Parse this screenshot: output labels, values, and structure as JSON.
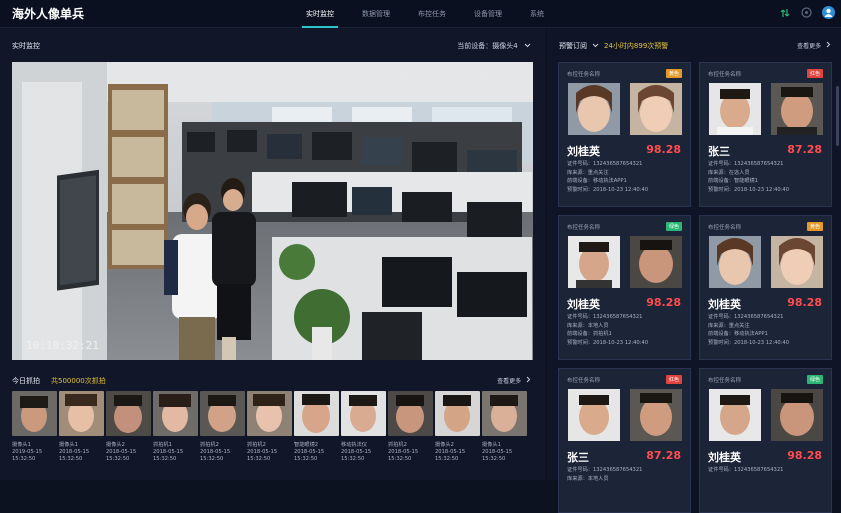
{
  "app": {
    "title": "海外人像单兵"
  },
  "nav": [
    "实时监控",
    "数据管理",
    "布控任务",
    "设备管理",
    "系统"
  ],
  "live": {
    "section_title": "实时监控",
    "device_label": "当前设备：摄像头4",
    "timestamp_top": "2018-05-15 10:16:52",
    "timestamp_bottom": "10:10:32:21"
  },
  "captures": {
    "title": "今日抓拍",
    "count": "共500000次抓拍",
    "see_more": "查看更多",
    "items": [
      {
        "camera": "摄像头1",
        "date": "2019-05-15",
        "time": "15:32:50"
      },
      {
        "camera": "摄像头1",
        "date": "2018-05-15",
        "time": "15:32:50"
      },
      {
        "camera": "摄像头2",
        "date": "2018-05-15",
        "time": "15:32:50"
      },
      {
        "camera": "抓拍机1",
        "date": "2018-05-15",
        "time": "15:32:50"
      },
      {
        "camera": "抓拍机2",
        "date": "2018-05-15",
        "time": "15:32:50"
      },
      {
        "camera": "抓拍机2",
        "date": "2018-05-15",
        "time": "15:32:50"
      },
      {
        "camera": "智能眼镜2",
        "date": "2018-05-15",
        "time": "15:32:50"
      },
      {
        "camera": "移动执法仪",
        "date": "2018-05-15",
        "time": "15:32:50"
      },
      {
        "camera": "抓拍机2",
        "date": "2018-05-15",
        "time": "15:32:50"
      },
      {
        "camera": "摄像头2",
        "date": "2018-05-15",
        "time": "15:32:50"
      },
      {
        "camera": "摄像头1",
        "date": "2018-05-15",
        "time": "15:32:50"
      }
    ]
  },
  "alerts": {
    "title": "预警订阅",
    "count": "24小时内899次预警",
    "see_more": "查看更多",
    "cards": [
      {
        "task": "布控任务名称",
        "badge": "黄色",
        "badge_color": "#e39a2b",
        "name": "刘桂英",
        "score": "98.28",
        "id": "证件号码：132436587654321",
        "lib": "库来源：重点关注",
        "device": "前端设备：移动执法APP1",
        "time": "预警时间：2018-10-23  12:40:40"
      },
      {
        "task": "布控任务名称",
        "badge": "红色",
        "badge_color": "#e0443f",
        "name": "张三",
        "score": "87.28",
        "id": "证件号码：132436587654321",
        "lib": "库来源：在逃人员",
        "device": "前端设备：智能眼镜1",
        "time": "预警时间：2018-10-23  12:40:40"
      },
      {
        "task": "布控任务名称",
        "badge": "绿色",
        "badge_color": "#2bb673",
        "name": "刘桂英",
        "score": "98.28",
        "id": "证件号码：132436587654321",
        "lib": "库来源：本地人员",
        "device": "前端设备：抓拍机1",
        "time": "预警时间：2018-10-23  12:40:40"
      },
      {
        "task": "布控任务名称",
        "badge": "黄色",
        "badge_color": "#e39a2b",
        "name": "刘桂英",
        "score": "98.28",
        "id": "证件号码：132436587654321",
        "lib": "库来源：重点关注",
        "device": "前端设备：移动执法APP1",
        "time": "预警时间：2018-10-23  12:40:40"
      },
      {
        "task": "布控任务名称",
        "badge": "红色",
        "badge_color": "#e0443f",
        "name": "张三",
        "score": "87.28",
        "id": "证件号码：132436587654321",
        "lib": "库来源：本地人员",
        "device": "",
        "time": ""
      },
      {
        "task": "布控任务名称",
        "badge": "绿色",
        "badge_color": "#2bb673",
        "name": "刘桂英",
        "score": "98.28",
        "id": "证件号码：132436587654321",
        "lib": "",
        "device": "",
        "time": ""
      }
    ]
  },
  "icons": [
    "signal-icon",
    "notification-icon",
    "user-avatar-icon",
    "chevron-down-icon",
    "chevron-right-icon"
  ],
  "colors": {
    "accent": "#2fc3c9",
    "score": "#ff4d4f",
    "highlight": "#e4c23c"
  }
}
